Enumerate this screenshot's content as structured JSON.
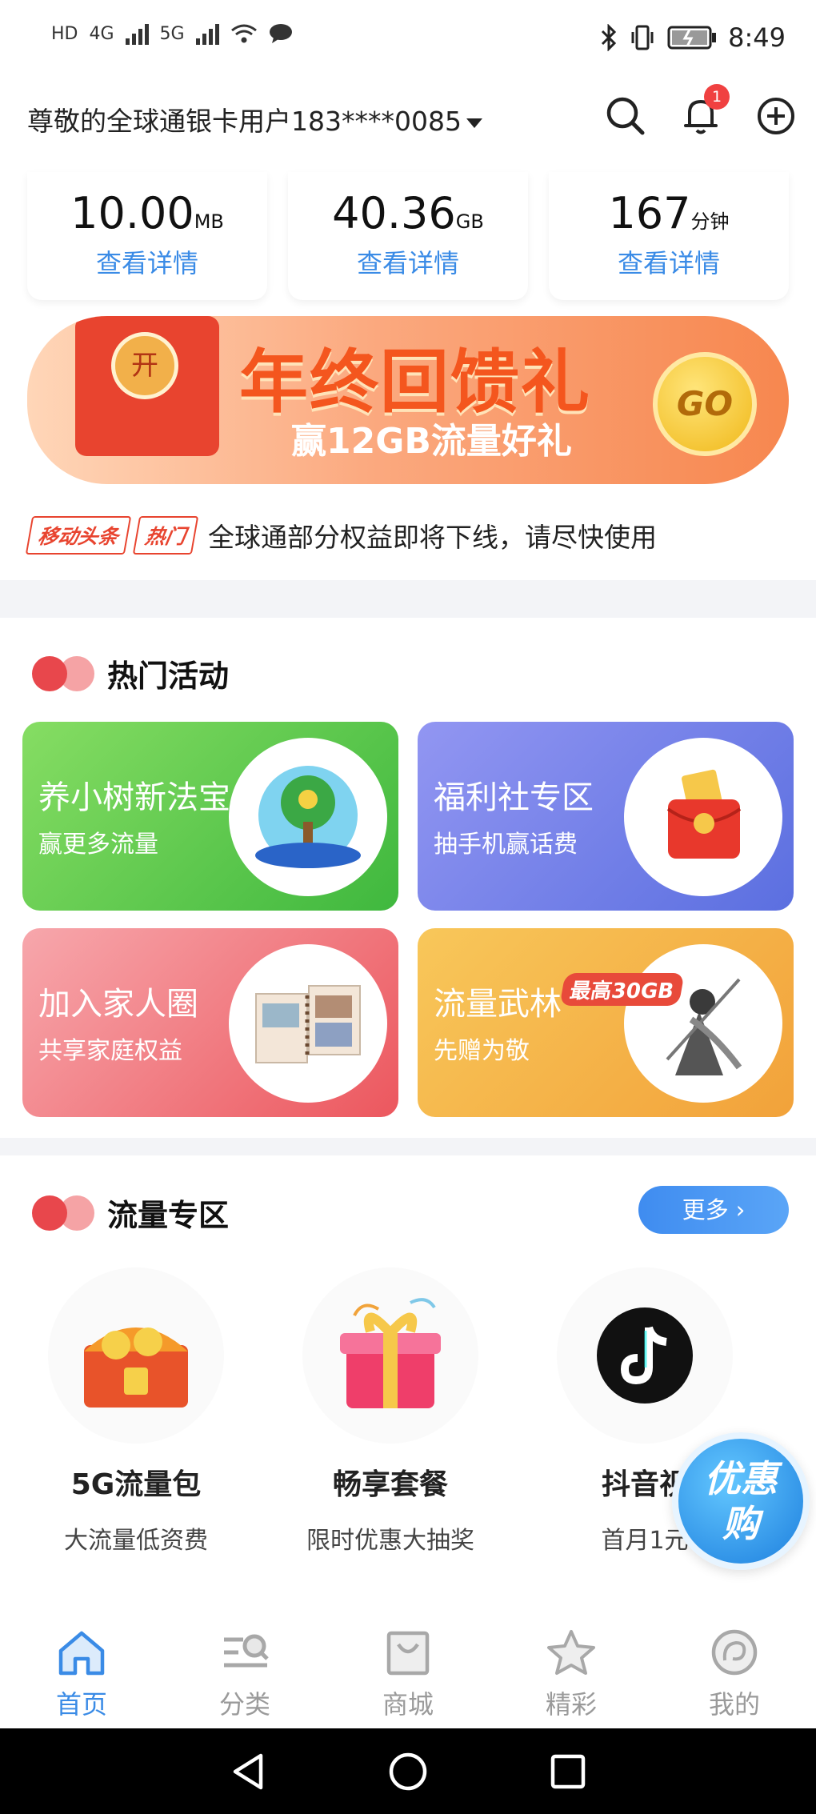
{
  "status_bar": {
    "left": [
      "HD",
      "4G",
      "5G"
    ],
    "time": "8:49"
  },
  "header": {
    "greeting": "尊敬的全球通银卡用户183****0085",
    "notification_count": "1"
  },
  "usage": [
    {
      "value": "10.00",
      "unit": "MB",
      "link": "查看详情"
    },
    {
      "value": "40.36",
      "unit": "GB",
      "link": "查看详情"
    },
    {
      "value": "167",
      "unit": "分钟",
      "link": "查看详情"
    }
  ],
  "banner": {
    "open_label": "开",
    "title": "年终回馈礼",
    "subtitle": "赢12GB流量好礼",
    "go_label": "GO"
  },
  "news": {
    "tag1": "移动头条",
    "tag2": "热门",
    "text": "全球通部分权益即将下线，请尽快使用"
  },
  "hot_activities": {
    "title": "热门活动",
    "items": [
      {
        "title": "养小树新法宝",
        "subtitle": "赢更多流量",
        "color_from": "#77d65a",
        "color_to": "#3fb83e"
      },
      {
        "title": "福利社专区",
        "subtitle": "抽手机赢话费",
        "color_from": "#8c8ff0",
        "color_to": "#5c6fe2"
      },
      {
        "title": "加入家人圈",
        "subtitle": "共享家庭权益",
        "color_from": "#f59aa0",
        "color_to": "#ee5b62"
      },
      {
        "title": "流量武林",
        "subtitle": "先赠为敬",
        "tag": "最高30GB",
        "color_from": "#f6c257",
        "color_to": "#f2a23a"
      }
    ]
  },
  "traffic_zone": {
    "title": "流量专区",
    "more_label": "更多",
    "products": [
      {
        "name": "5G流量包",
        "subtitle": "大流量低资费"
      },
      {
        "name": "畅享套餐",
        "subtitle": "限时优惠大抽奖"
      },
      {
        "name": "抖音视",
        "subtitle": "首月1元"
      }
    ]
  },
  "float_promo": {
    "line1": "优惠",
    "line2": "购"
  },
  "tabbar": {
    "tabs": [
      {
        "label": "首页",
        "icon": "home-icon",
        "active": true
      },
      {
        "label": "分类",
        "icon": "category-icon",
        "active": false
      },
      {
        "label": "商城",
        "icon": "shop-bag-icon",
        "active": false
      },
      {
        "label": "精彩",
        "icon": "star-icon",
        "active": false
      },
      {
        "label": "我的",
        "icon": "profile-icon",
        "active": false
      }
    ]
  },
  "colors": {
    "accent_blue": "#3a8be6",
    "badge_red": "#f04141",
    "section_dot_dark": "#e8474c",
    "section_dot_light": "#f5a3a5"
  }
}
